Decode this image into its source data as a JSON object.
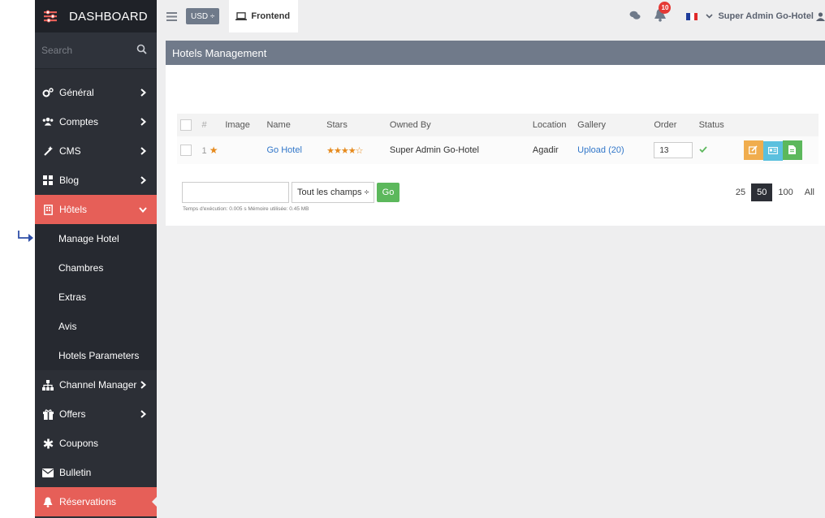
{
  "brand": {
    "title": "DASHBOARD"
  },
  "search": {
    "placeholder": "Search"
  },
  "sidebar": {
    "items": [
      {
        "label": "Général",
        "icon": "cogs-icon"
      },
      {
        "label": "Comptes",
        "icon": "users-icon"
      },
      {
        "label": "CMS",
        "icon": "magic-wand-icon"
      },
      {
        "label": "Blog",
        "icon": "grid-icon"
      },
      {
        "label": "Hôtels",
        "icon": "building-icon"
      }
    ],
    "hotels_sub": [
      "Manage Hotel",
      "Chambres",
      "Extras",
      "Avis",
      "Hotels Parameters"
    ],
    "bottom_items": [
      {
        "label": "Channel Manager",
        "icon": "sitemap-icon"
      },
      {
        "label": "Offers",
        "icon": "gift-icon"
      },
      {
        "label": "Coupons",
        "icon": "asterisk-icon"
      },
      {
        "label": "Bulletin",
        "icon": "envelope-icon"
      },
      {
        "label": "Réservations",
        "icon": "bell-icon"
      }
    ]
  },
  "topbar": {
    "currency": "USD ÷",
    "frontend": "Frontend",
    "notifications": "10",
    "user": "Super Admin Go-Hotel"
  },
  "panel": {
    "title": "Hotels Management"
  },
  "table": {
    "headers": [
      "#",
      "Image",
      "Name",
      "Stars",
      "Owned By",
      "Location",
      "Gallery",
      "Order",
      "Status"
    ],
    "rows": [
      {
        "num": "1",
        "name": "Go Hotel",
        "stars": "★★★★☆",
        "owner": "Super Admin Go-Hotel",
        "location": "Agadir",
        "gallery": "Upload (20)",
        "order": "13"
      }
    ]
  },
  "filter": {
    "select": "Tout les champs ÷",
    "go": "Go",
    "exec": "Temps d'exécution: 0.005 s   Mémoire utilisée: 0.45 MB"
  },
  "pager": [
    "25",
    "50",
    "100",
    "All"
  ],
  "colors": {
    "sidebar": "#2c2f36",
    "active": "#e65f58",
    "header": "#707a8a",
    "link": "#3277c9"
  }
}
